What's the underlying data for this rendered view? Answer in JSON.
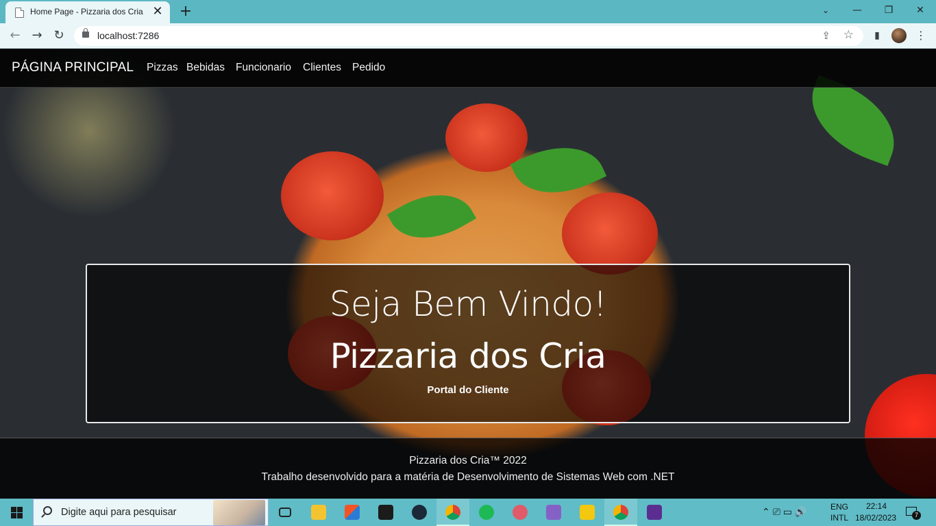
{
  "browser": {
    "tab_title": "Home Page - Pizzaria dos Cria",
    "url": "localhost:7286",
    "close_tab": "✕",
    "new_tab": "+",
    "minimize": "—",
    "restore": "❐",
    "close_window": "✕",
    "back": "←",
    "forward": "→",
    "reload": "↻",
    "share": "⇪",
    "bookmark": "☆",
    "sidepanel": "▮"
  },
  "nav": {
    "brand": "PÁGINA PRINCIPAL",
    "links": [
      "Pizzas",
      "Bebidas",
      "Funcionario",
      "Clientes",
      "Pedido"
    ]
  },
  "hero": {
    "line1": "Seja Bem Vindo!",
    "line2": "Pizzaria dos Cria",
    "subtitle": "Portal do Cliente"
  },
  "footer": {
    "line1": "Pizzaria dos Cria™ 2022",
    "line2": "Trabalho desenvolvido para a matéria de Desenvolvimento de Sistemas Web com .NET"
  },
  "taskbar": {
    "search_placeholder": "Digite aqui para pesquisar",
    "apps": [
      {
        "name": "task-view-icon",
        "color": "#222222"
      },
      {
        "name": "file-explorer-icon",
        "color": "#f4c430"
      },
      {
        "name": "microsoft-store-icon",
        "color": "#2b7bd6"
      },
      {
        "name": "epic-games-icon",
        "color": "#1b1b1b"
      },
      {
        "name": "steam-icon",
        "color": "#1b2838"
      },
      {
        "name": "chrome-icon",
        "color": "#db4437"
      },
      {
        "name": "spotify-icon",
        "color": "#1db954"
      },
      {
        "name": "app-icon",
        "color": "#e05a6a"
      },
      {
        "name": "visual-studio-icon",
        "color": "#8661c5"
      },
      {
        "name": "app-icon-2",
        "color": "#f2c811"
      },
      {
        "name": "chrome-icon-active",
        "color": "#db4437"
      },
      {
        "name": "terminal-icon",
        "color": "#5c2d91"
      }
    ],
    "lang1": "ENG",
    "lang2": "INTL",
    "time": "22:14",
    "date": "18/02/2023",
    "notifications": "7",
    "tray_icons": "⌃  ⎚  ▭  🔊"
  }
}
